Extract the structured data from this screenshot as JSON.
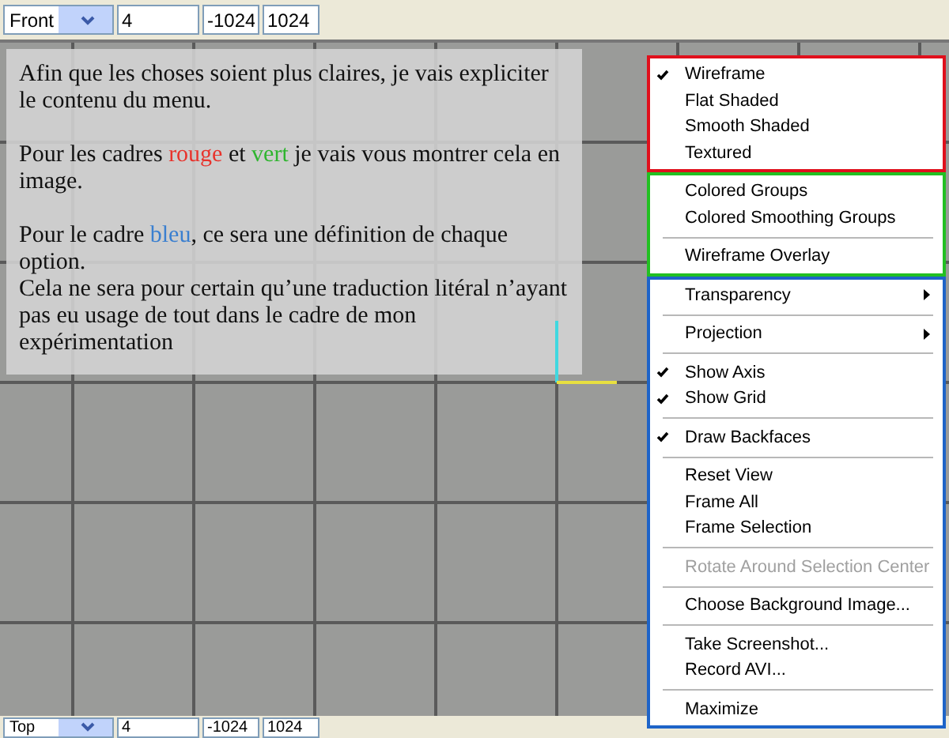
{
  "top_toolbar": {
    "view": "Front",
    "fields": [
      "4",
      "-1024",
      "1024"
    ]
  },
  "note": {
    "paragraphs": [
      {
        "kind": "paragraph",
        "segments": [
          {
            "text": "Afin que les choses soient plus claires, je vais expliciter le contenu du menu."
          }
        ]
      },
      {
        "kind": "paragraph",
        "segments": [
          {
            "text": "Pour les cadres "
          },
          {
            "text": "rouge",
            "color": "#e8332c"
          },
          {
            "text": " et "
          },
          {
            "text": "vert",
            "color": "#2fb52f"
          },
          {
            "text": " je vais vous montrer cela en image."
          }
        ]
      },
      {
        "kind": "paragraph",
        "segments": [
          {
            "text": "Pour le cadre "
          },
          {
            "text": "bleu",
            "color": "#3a7fd0"
          },
          {
            "text": ", ce sera une définition de chaque option."
          }
        ]
      },
      {
        "kind": "line",
        "segments": [
          {
            "text": "Cela ne sera pour certain qu’une traduction litéral n’ayant pas eu usage de tout dans le cadre de mon expérimentation"
          }
        ]
      }
    ]
  },
  "menu": {
    "groups": [
      {
        "color": "#e0101c",
        "items": [
          {
            "kind": "item",
            "label": "Wireframe",
            "checked": true,
            "disabled": false
          },
          {
            "kind": "item",
            "label": "Flat Shaded",
            "checked": false,
            "disabled": false
          },
          {
            "kind": "item",
            "label": "Smooth Shaded",
            "checked": false,
            "disabled": false
          },
          {
            "kind": "item",
            "label": "Textured",
            "checked": false,
            "disabled": false
          }
        ]
      },
      {
        "color": "#22c022",
        "items": [
          {
            "kind": "item",
            "label": "Colored Groups",
            "checked": false,
            "disabled": false
          },
          {
            "kind": "item",
            "label": "Colored Smoothing Groups",
            "checked": false,
            "disabled": false
          },
          {
            "kind": "separator"
          },
          {
            "kind": "item",
            "label": "Wireframe Overlay",
            "checked": false,
            "disabled": false
          }
        ]
      },
      {
        "color": "#1e64c8",
        "items": [
          {
            "kind": "submenu",
            "label": "Transparency",
            "checked": false,
            "disabled": false
          },
          {
            "kind": "separator"
          },
          {
            "kind": "submenu",
            "label": "Projection",
            "checked": false,
            "disabled": false
          },
          {
            "kind": "separator"
          },
          {
            "kind": "item",
            "label": "Show Axis",
            "checked": true,
            "disabled": false
          },
          {
            "kind": "item",
            "label": "Show Grid",
            "checked": true,
            "disabled": false
          },
          {
            "kind": "separator"
          },
          {
            "kind": "item",
            "label": "Draw Backfaces",
            "checked": true,
            "disabled": false
          },
          {
            "kind": "separator"
          },
          {
            "kind": "item",
            "label": "Reset View",
            "checked": false,
            "disabled": false
          },
          {
            "kind": "item",
            "label": "Frame All",
            "checked": false,
            "disabled": false
          },
          {
            "kind": "item",
            "label": "Frame Selection",
            "checked": false,
            "disabled": false
          },
          {
            "kind": "separator"
          },
          {
            "kind": "item",
            "label": "Rotate Around Selection Center",
            "checked": false,
            "disabled": true
          },
          {
            "kind": "separator"
          },
          {
            "kind": "item",
            "label": "Choose Background Image...",
            "checked": false,
            "disabled": false
          },
          {
            "kind": "separator"
          },
          {
            "kind": "item",
            "label": "Take Screenshot...",
            "checked": false,
            "disabled": false
          },
          {
            "kind": "item",
            "label": "Record AVI...",
            "checked": false,
            "disabled": false
          },
          {
            "kind": "separator"
          },
          {
            "kind": "item",
            "label": "Maximize",
            "checked": false,
            "disabled": false
          }
        ]
      }
    ]
  },
  "bottom_toolbar": {
    "view": "Top",
    "fields": [
      "4",
      "-1024",
      "1024"
    ]
  }
}
